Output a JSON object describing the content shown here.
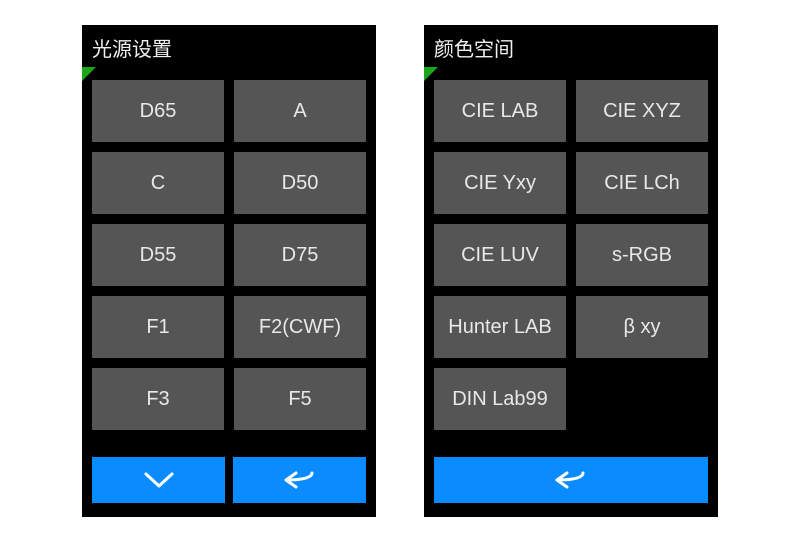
{
  "screens": [
    {
      "title": "光源设置",
      "options": [
        "D65",
        "A",
        "C",
        "D50",
        "D55",
        "D75",
        "F1",
        "F2(CWF)",
        "F3",
        "F5"
      ],
      "bottom": [
        "down",
        "back"
      ]
    },
    {
      "title": "颜色空间",
      "options": [
        "CIE LAB",
        "CIE XYZ",
        "CIE Yxy",
        "CIE LCh",
        "CIE LUV",
        "s-RGB",
        "Hunter LAB",
        "β xy",
        "DIN Lab99"
      ],
      "bottom": [
        "back"
      ]
    }
  ],
  "colors": {
    "accent": "#0a8cff",
    "button": "#555555"
  }
}
